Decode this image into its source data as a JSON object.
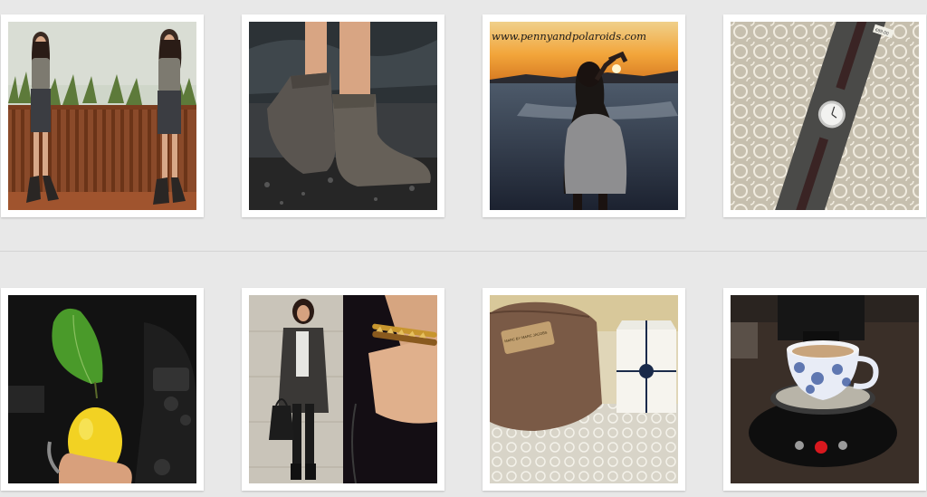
{
  "gallery": {
    "watermark": "www.pennyandpolaroids.com",
    "price_tag": "€89.00",
    "bag_label": "MARC BY MARC JACOBS",
    "photos": [
      {
        "subject": "outfit-collage-grey-top-leather-skirt"
      },
      {
        "subject": "suede-ankle-boots"
      },
      {
        "subject": "sunset-heart-hands-beach"
      },
      {
        "subject": "boxed-watch-on-lace"
      },
      {
        "subject": "lemon-in-hand-car"
      },
      {
        "subject": "grey-coat-outfit-and-bracelets"
      },
      {
        "subject": "brown-pouch-and-gift-box"
      },
      {
        "subject": "coffee-machine-blue-cup"
      }
    ]
  }
}
